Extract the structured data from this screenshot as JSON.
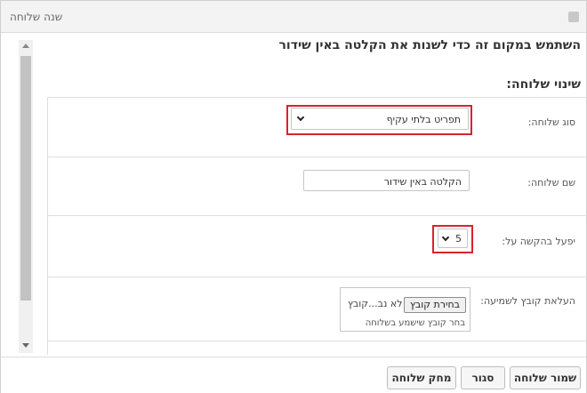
{
  "dialog": {
    "title": "שנה שלוחה"
  },
  "intro": "השתמש במקום זה כדי לשנות את הקלטה באין שידור",
  "section_title": "שינוי שלוחה:",
  "form": {
    "type": {
      "label": "סוג שלוחה:",
      "value": "תפריט בלתי עקיף"
    },
    "name": {
      "label": "שם שלוחה:",
      "value": "הקלטה באין שידור"
    },
    "trigger": {
      "label": "יפעל בהקשה על:",
      "value": "5"
    },
    "upload": {
      "label": "העלאת קובץ לשמיעה:",
      "button": "בחירת קובץ",
      "no_file": "לא נב...קובץ",
      "hint": "בחר קובץ שישמע בשלוחה"
    }
  },
  "footer": {
    "save": "שמור שלוחה",
    "close": "סגור",
    "delete": "מחק שלוחה"
  },
  "colors": {
    "highlight": "#d9232d"
  },
  "icons": [
    "close-icon",
    "chevron-down-icon",
    "scroll-up-icon",
    "scroll-down-icon"
  ]
}
